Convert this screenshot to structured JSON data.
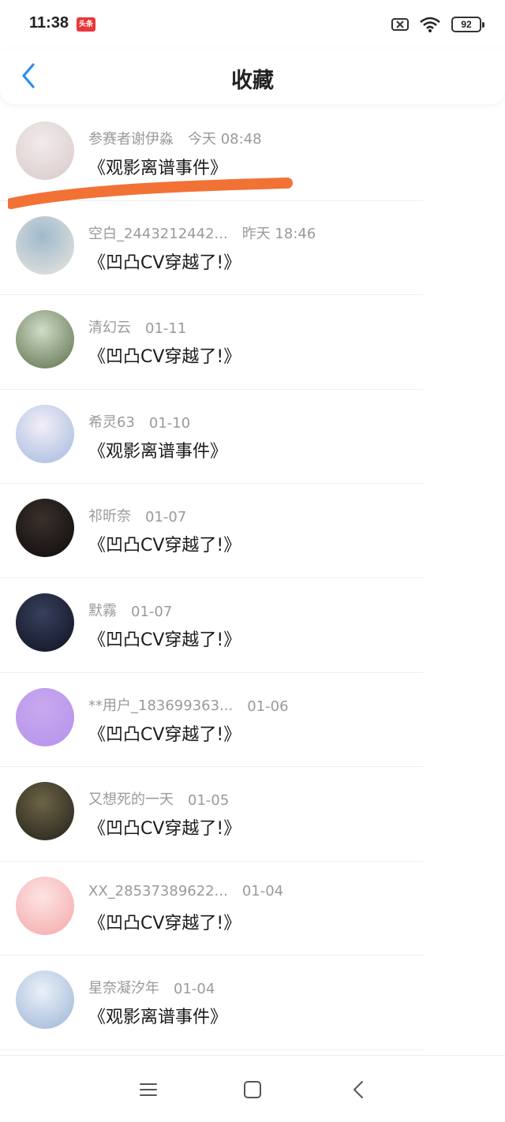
{
  "status": {
    "time": "11:38",
    "app_badge": "头条",
    "battery": "92"
  },
  "header": {
    "title": "收藏",
    "back_icon": "chevron-left-icon",
    "accent": "#2b8ef3"
  },
  "items": [
    {
      "user": "参赛者谢伊淼",
      "date": "今天 08:48",
      "book": "《观影离谱事件》",
      "avatar_colors": [
        "#f1ecec",
        "#d9c8c8"
      ]
    },
    {
      "user": "空白_2443212442...",
      "date": "昨天 18:46",
      "book": "《凹凸CV穿越了!》",
      "avatar_colors": [
        "#9fb9cc",
        "#e9e6df"
      ]
    },
    {
      "user": "清幻云",
      "date": "01-11",
      "book": "《凹凸CV穿越了!》",
      "avatar_colors": [
        "#cfdcc7",
        "#5c6e4a"
      ]
    },
    {
      "user": "希灵63",
      "date": "01-10",
      "book": "《观影离谱事件》",
      "avatar_colors": [
        "#f3eef6",
        "#a3b9e0"
      ]
    },
    {
      "user": "祁昕奈",
      "date": "01-07",
      "book": "《凹凸CV穿越了!》",
      "avatar_colors": [
        "#3a302c",
        "#0d0b0a"
      ]
    },
    {
      "user": "默霧",
      "date": "01-07",
      "book": "《凹凸CV穿越了!》",
      "avatar_colors": [
        "#37405c",
        "#0f1220"
      ]
    },
    {
      "user": "**用户_183699363...",
      "date": "01-06",
      "book": "《凹凸CV穿越了!》",
      "avatar_colors": [
        "#c8a9f0",
        "#b592ea"
      ]
    },
    {
      "user": "又想死的一天",
      "date": "01-05",
      "book": "《凹凸CV穿越了!》",
      "avatar_colors": [
        "#6c6446",
        "#22201a"
      ]
    },
    {
      "user": "XX_28537389622...",
      "date": "01-04",
      "book": "《凹凸CV穿越了!》",
      "avatar_colors": [
        "#fde4e4",
        "#f4a7a7"
      ]
    },
    {
      "user": "星奈凝汐年",
      "date": "01-04",
      "book": "《观影离谱事件》",
      "avatar_colors": [
        "#eaf1f8",
        "#9cb4d6"
      ]
    }
  ],
  "navbar": {
    "menu_icon": "menu-icon",
    "home_icon": "home-square-icon",
    "back_icon": "back-triangle-icon"
  }
}
